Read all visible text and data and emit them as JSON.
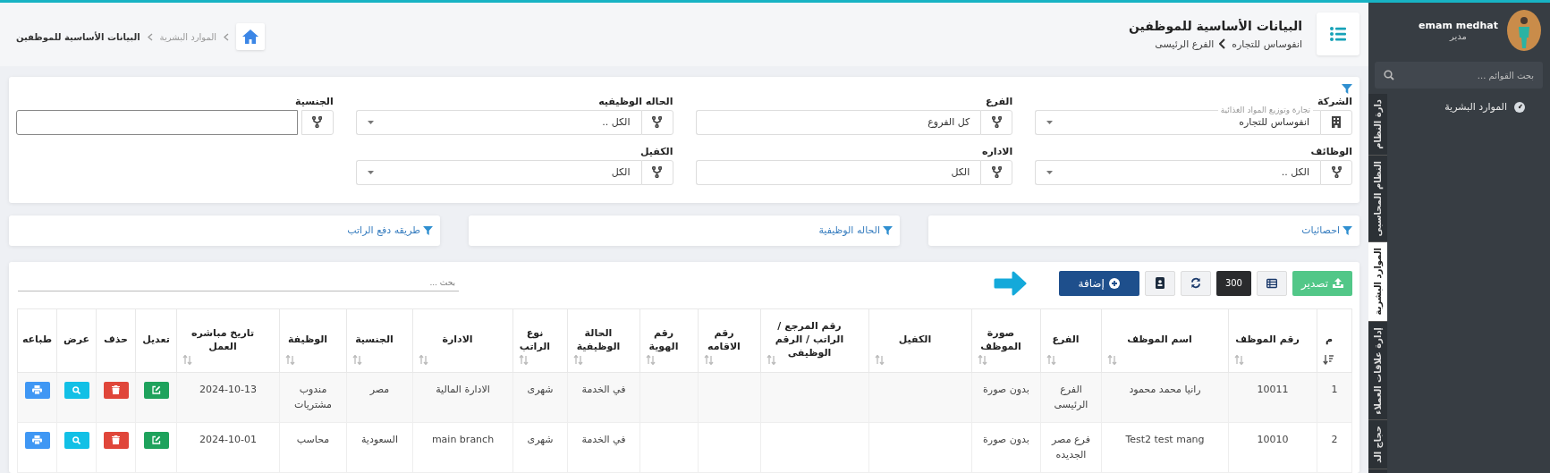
{
  "header": {
    "title": "البيانات الأساسية للموظفين",
    "company": "انفوساس للتجاره",
    "branch": "الفرع الرئيسى",
    "breadcrumbs": [
      "الموارد البشرية",
      "البيانات الأساسية للموظفين"
    ]
  },
  "sidebar": {
    "user_name": "emam medhat",
    "user_role": "مدير",
    "search": {
      "placeholder": "بحث القوائم ..."
    },
    "items": [
      "الموارد البشرية"
    ],
    "tabs": [
      {
        "label": "دارة النظام",
        "selected": false
      },
      {
        "label": "النظام المحاسبى",
        "selected": false
      },
      {
        "label": "الموارد البشرية",
        "selected": true
      },
      {
        "label": "إدارة علاقات العملاء",
        "selected": false
      },
      {
        "label": "حجاج الد",
        "selected": false
      }
    ]
  },
  "filters": {
    "fields": [
      {
        "label": "الشركة",
        "kind": "company",
        "floating_label": "تجارة وتوزيع المواد الغذائية",
        "value": "انفوساس للتجاره"
      },
      {
        "label": "الفرع",
        "kind": "plain",
        "value": "كل الفروع"
      },
      {
        "label": "الحاله الوظيفيه",
        "kind": "select",
        "value": "الكل .."
      },
      {
        "label": "الجنسية",
        "kind": "text"
      },
      {
        "label": "الوظائف",
        "kind": "select",
        "value": "الكل .."
      },
      {
        "label": "الاداره",
        "kind": "plain",
        "value": "الكل"
      },
      {
        "label": "الكفيل",
        "kind": "select",
        "value": "الكل"
      }
    ]
  },
  "panels": [
    "احصائيات",
    "الحاله الوظيفية",
    "طريقه دفع الراتب"
  ],
  "toolbar": {
    "buttons": [
      {
        "kind": "export",
        "label": "تصدير"
      },
      {
        "kind": "columns"
      },
      {
        "kind": "page-size",
        "label": "300"
      },
      {
        "kind": "refresh"
      },
      {
        "kind": "contacts"
      },
      {
        "kind": "add",
        "label": "إضافة"
      }
    ],
    "search": {
      "placeholder": "بحث ..."
    }
  },
  "table": {
    "columns": [
      {
        "label": "م",
        "kind": "data",
        "sorted": true
      },
      {
        "label": "رقم الموظف",
        "kind": "data",
        "sorted": false
      },
      {
        "label": "اسم الموظف",
        "kind": "data",
        "sorted": false
      },
      {
        "label": "الفرع",
        "kind": "data",
        "sorted": false
      },
      {
        "label": "صورة الموظف",
        "kind": "data",
        "sorted": false
      },
      {
        "label": "الكفيل",
        "kind": "data",
        "sorted": false
      },
      {
        "label": "رقم المرجع / الراتب / الرقم الوظيفى",
        "kind": "data",
        "sorted": false
      },
      {
        "label": "رقم الاقامه",
        "kind": "data",
        "sorted": false
      },
      {
        "label": "رقم الهوية",
        "kind": "data",
        "sorted": false
      },
      {
        "label": "الحالة الوظيفية",
        "kind": "data",
        "sorted": false
      },
      {
        "label": "نوع الراتب",
        "kind": "data",
        "sorted": false
      },
      {
        "label": "الادارة",
        "kind": "data",
        "sorted": false
      },
      {
        "label": "الجنسية",
        "kind": "data",
        "sorted": false
      },
      {
        "label": "الوظيفة",
        "kind": "data",
        "sorted": false
      },
      {
        "label": "تاريخ مباشره العمل",
        "kind": "data",
        "sorted": false
      },
      {
        "label": "تعديل",
        "kind": "edit"
      },
      {
        "label": "حذف",
        "kind": "delete"
      },
      {
        "label": "عرض",
        "kind": "view"
      },
      {
        "label": "طباعه",
        "kind": "print"
      }
    ],
    "rows": [
      [
        "1",
        "10011",
        "رانيا محمد محمود",
        "الفرع الرئيسى",
        "بدون صورة",
        null,
        null,
        null,
        null,
        "في الخدمة",
        "شهرى",
        "الادارة المالية",
        "مصر",
        "مندوب مشتريات",
        "2024-10-13"
      ],
      [
        "2",
        "10010",
        "Test2 test mang",
        "فرع مصر الجديده",
        "بدون صورة",
        null,
        null,
        null,
        null,
        "في الخدمة",
        "شهرى",
        "main branch",
        "السعودية",
        "محاسب",
        "2024-10-01"
      ]
    ]
  }
}
